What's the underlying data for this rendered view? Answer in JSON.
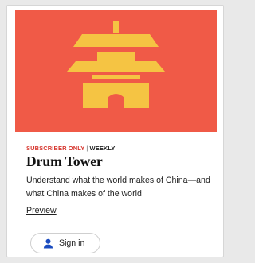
{
  "card": {
    "hero_bg": "#f05a47",
    "tower_color": "#f5c443",
    "label": {
      "tag": "Subscriber Only",
      "separator": "|",
      "frequency": "Weekly"
    },
    "title": "Drum Tower",
    "description": "Understand what the world makes of China—and what China makes of the world",
    "preview_link": "Preview",
    "sign_in": {
      "icon": "person-icon",
      "label": "Sign in",
      "icon_color": "#1a4bbf"
    }
  }
}
